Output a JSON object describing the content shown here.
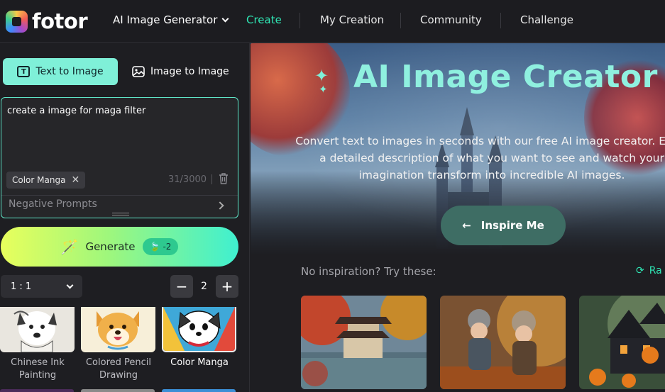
{
  "header": {
    "logo_text": "fotor",
    "product_menu_label": "AI Image Generator",
    "nav": [
      {
        "label": "Create",
        "active": true
      },
      {
        "label": "My Creation",
        "active": false
      },
      {
        "label": "Community",
        "active": false
      },
      {
        "label": "Challenge",
        "active": false
      }
    ]
  },
  "sidebar": {
    "tabs": [
      {
        "label": "Text to Image",
        "active": true
      },
      {
        "label": "Image to Image",
        "active": false
      }
    ],
    "prompt": {
      "value": "create a image for maga filter",
      "style_chip": "Color Manga",
      "counter": "31/3000",
      "negative_label": "Negative Prompts"
    },
    "generate": {
      "label": "Generate",
      "cost": "-2"
    },
    "ratio": "1 : 1",
    "quantity": "2",
    "styles": [
      {
        "label": "Chinese Ink Painting",
        "selected": false
      },
      {
        "label": "Colored Pencil Drawing",
        "selected": false
      },
      {
        "label": "Color Manga",
        "selected": true
      }
    ]
  },
  "hero": {
    "title": "AI Image Creator",
    "description": "Convert text to images in seconds with our free AI image creator. Enter a detailed description of what you want to see and watch your imagination transform into incredible AI images.",
    "inspire_label": "Inspire Me"
  },
  "inspiration": {
    "label": "No inspiration? Try these:",
    "random_label": "Ra"
  },
  "colors": {
    "accent": "#2fe6b4",
    "tab_active": "#7ff0d8"
  }
}
